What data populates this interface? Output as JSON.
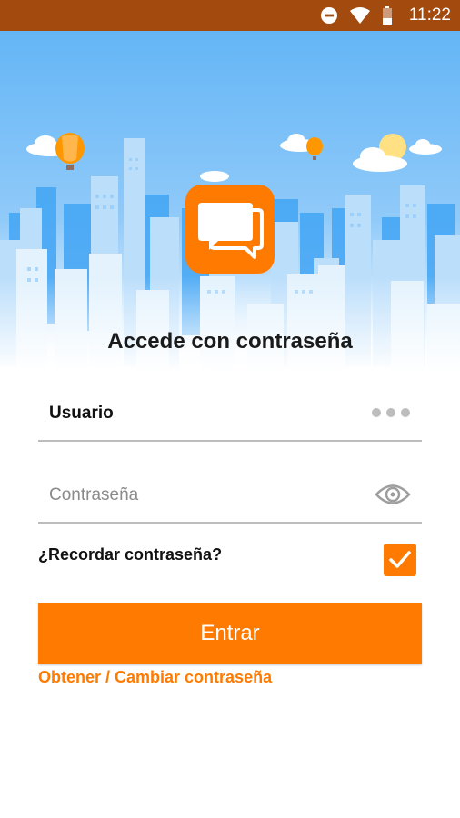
{
  "status_bar": {
    "time": "11:22",
    "icons": [
      "do-not-disturb-icon",
      "wifi-icon",
      "battery-icon"
    ]
  },
  "login": {
    "title": "Accede con contraseña",
    "username_value": "Usuario",
    "password_placeholder": "Contraseña",
    "remember_label": "¿Recordar contraseña?",
    "remember_checked": true,
    "enter_button": "Entrar",
    "get_password_link": "Obtener / Cambiar contraseña"
  },
  "colors": {
    "accent": "#ff7a00",
    "status_bar": "#a34a0f",
    "sky": "#64b5f6"
  }
}
